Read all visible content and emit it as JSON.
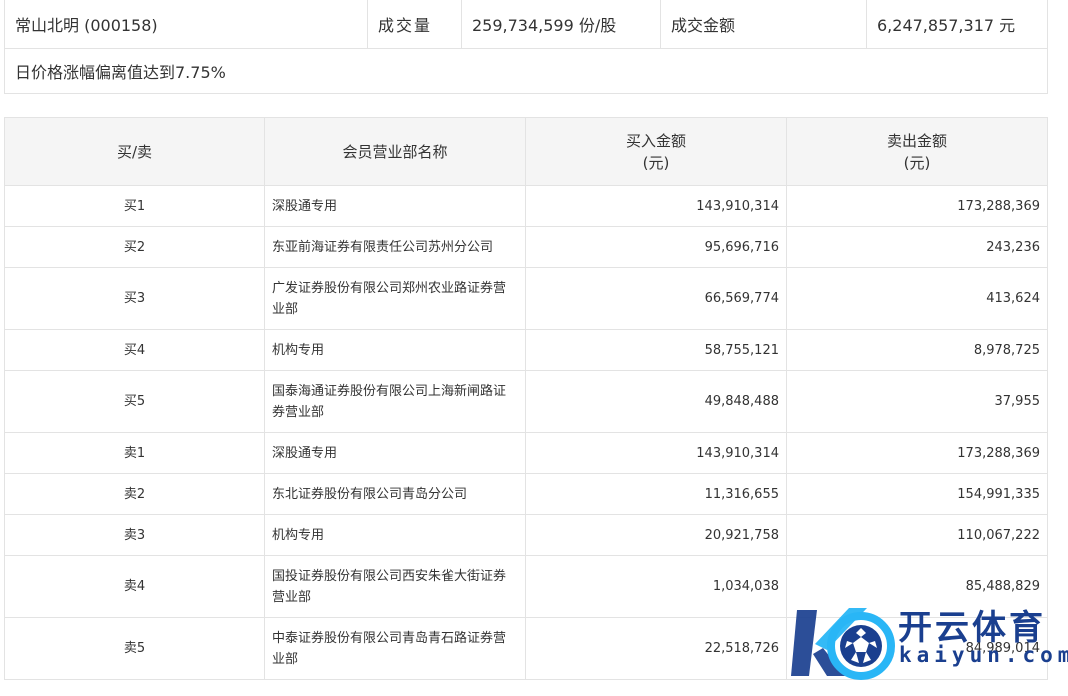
{
  "summary": {
    "stock_name": "常山北明 (000158)",
    "volume_label": "成交量",
    "volume_value": "259,734,599 份/股",
    "amount_label": "成交金额",
    "amount_value": "6,247,857,317 元",
    "note": "日价格涨幅偏离值达到7.75%"
  },
  "detail": {
    "headers": {
      "direction": "买/卖",
      "branch": "会员营业部名称",
      "buy_line1": "买入金额",
      "buy_line2": "(元)",
      "sell_line1": "卖出金额",
      "sell_line2": "(元)"
    },
    "rows": [
      {
        "direction": "买1",
        "branch": "深股通专用",
        "buy": "143,910,314",
        "sell": "173,288,369"
      },
      {
        "direction": "买2",
        "branch": "东亚前海证券有限责任公司苏州分公司",
        "buy": "95,696,716",
        "sell": "243,236"
      },
      {
        "direction": "买3",
        "branch": "广发证券股份有限公司郑州农业路证券营业部",
        "buy": "66,569,774",
        "sell": "413,624"
      },
      {
        "direction": "买4",
        "branch": "机构专用",
        "buy": "58,755,121",
        "sell": "8,978,725"
      },
      {
        "direction": "买5",
        "branch": "国泰海通证券股份有限公司上海新闸路证券营业部",
        "buy": "49,848,488",
        "sell": "37,955"
      },
      {
        "direction": "卖1",
        "branch": "深股通专用",
        "buy": "143,910,314",
        "sell": "173,288,369"
      },
      {
        "direction": "卖2",
        "branch": "东北证券股份有限公司青岛分公司",
        "buy": "11,316,655",
        "sell": "154,991,335"
      },
      {
        "direction": "卖3",
        "branch": "机构专用",
        "buy": "20,921,758",
        "sell": "110,067,222"
      },
      {
        "direction": "卖4",
        "branch": "国投证券股份有限公司西安朱雀大街证券营业部",
        "buy": "1,034,038",
        "sell": "85,488,829"
      },
      {
        "direction": "卖5",
        "branch": "中泰证券股份有限公司青岛青石路证券营业部",
        "buy": "22,518,726",
        "sell": "84,989,014"
      }
    ]
  },
  "watermark": {
    "brand": "开云体育",
    "site": "kaiyun.com",
    "colors": {
      "primary": "#1a3f8f",
      "accent": "#29b6f6"
    }
  }
}
